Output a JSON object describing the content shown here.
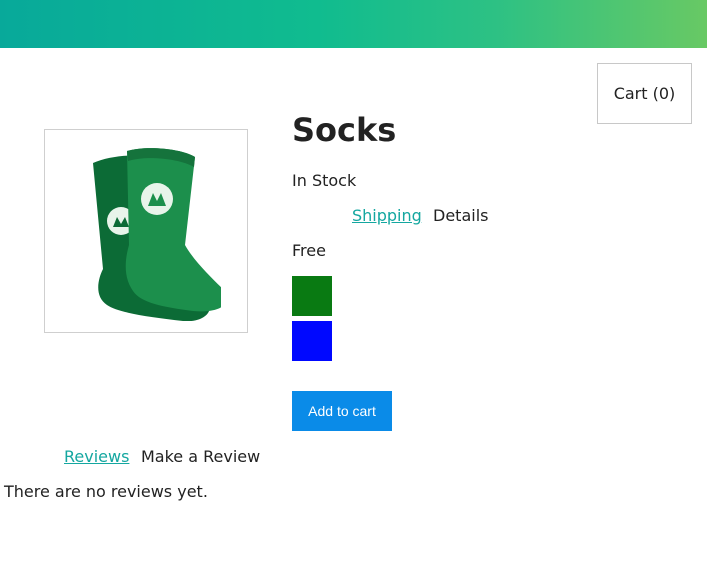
{
  "header": {
    "gradient_start": "#08a99a",
    "gradient_end": "#68c964"
  },
  "cart": {
    "label": "Cart (0)"
  },
  "product": {
    "title": "Socks",
    "image_icon": "socks-image",
    "stock_status": "In Stock",
    "tabs": [
      {
        "label": "Shipping",
        "active": true
      },
      {
        "label": "Details",
        "active": false
      }
    ],
    "shipping_value": "Free",
    "color_options": [
      {
        "name": "green",
        "color": "#097a12"
      },
      {
        "name": "blue",
        "color": "#0008ff"
      }
    ],
    "add_to_cart_label": "Add to cart",
    "add_to_cart_color": "#0a8be8"
  },
  "reviews": {
    "tabs": [
      {
        "label": "Reviews",
        "active": true
      },
      {
        "label": "Make a Review",
        "active": false
      }
    ],
    "empty_message": "There are no reviews yet."
  }
}
